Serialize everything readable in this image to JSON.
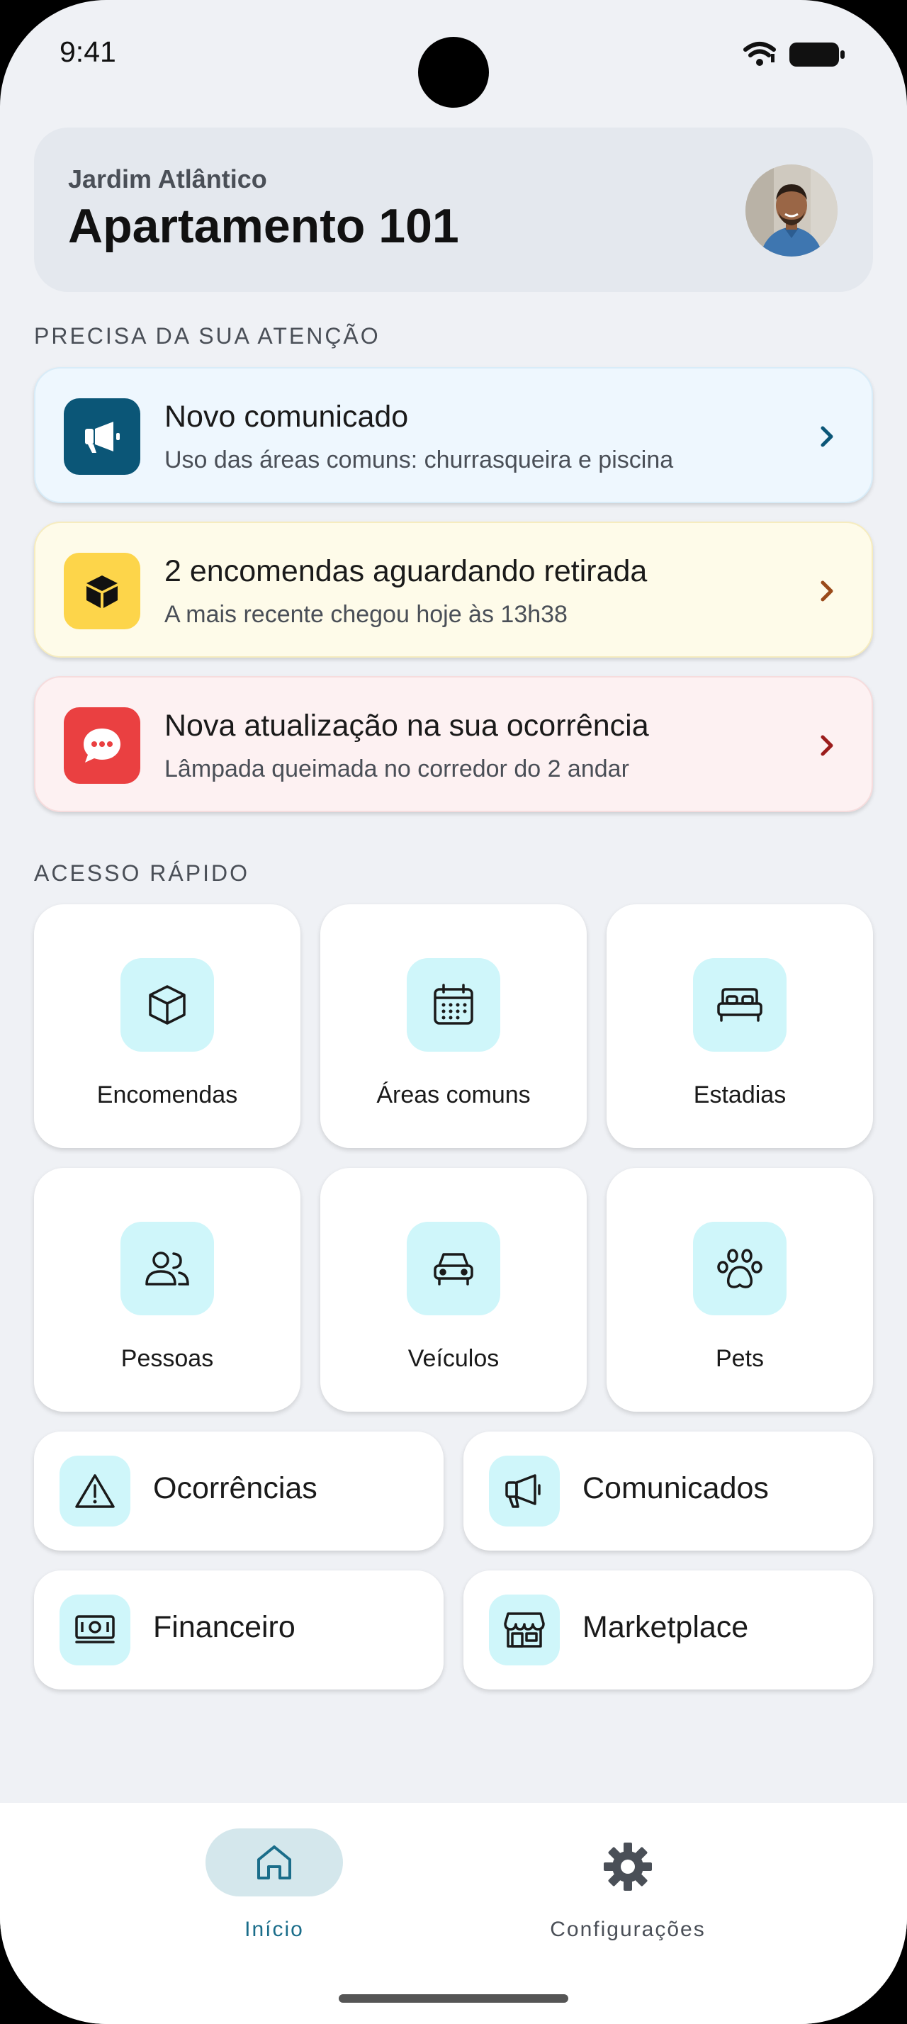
{
  "status_bar": {
    "time": "9:41"
  },
  "header": {
    "condominium": "Jardim Atlântico",
    "unit": "Apartamento 101",
    "avatar_icon": "user-avatar-photo"
  },
  "attention": {
    "section_title": "PRECISA DA SUA ATENÇÃO",
    "items": [
      {
        "title": "Novo comunicado",
        "subtitle": "Uso das áreas comuns: churrasqueira e piscina",
        "icon": "megaphone-icon",
        "bg": "#eef7fe",
        "icon_bg": "#0b5677",
        "chevron_color": "#0b5677"
      },
      {
        "title": "2 encomendas aguardando retirada",
        "subtitle": "A mais recente chegou hoje às 13h38",
        "icon": "package-icon",
        "bg": "#fefbe9",
        "icon_bg": "#fdd54a",
        "chevron_color": "#9a4a1a"
      },
      {
        "title": "Nova atualização na sua ocorrência",
        "subtitle": "Lâmpada queimada no corredor do 2 andar",
        "icon": "chat-bubble-icon",
        "bg": "#fdf1f2",
        "icon_bg": "#ea4041",
        "chevron_color": "#9b1c1c"
      }
    ]
  },
  "quick_access": {
    "section_title": "ACESSO RÁPIDO",
    "tiles": [
      {
        "label": "Encomendas",
        "icon": "box-icon"
      },
      {
        "label": "Áreas comuns",
        "icon": "calendar-icon"
      },
      {
        "label": "Estadias",
        "icon": "bed-icon"
      },
      {
        "label": "Pessoas",
        "icon": "people-icon"
      },
      {
        "label": "Veículos",
        "icon": "car-icon"
      },
      {
        "label": "Pets",
        "icon": "paw-icon"
      }
    ],
    "rows": [
      {
        "label": "Ocorrências",
        "icon": "warning-icon"
      },
      {
        "label": "Comunicados",
        "icon": "megaphone-icon"
      },
      {
        "label": "Financeiro",
        "icon": "money-icon"
      },
      {
        "label": "Marketplace",
        "icon": "store-icon"
      }
    ]
  },
  "bottom_nav": {
    "items": [
      {
        "label": "Início",
        "icon": "home-icon",
        "active": true
      },
      {
        "label": "Configurações",
        "icon": "gear-icon",
        "active": false
      }
    ],
    "active_color": "#1a6d8a",
    "inactive_color": "#4a4f57"
  },
  "colors": {
    "background": "#eff1f5",
    "tile_icon_bg": "#cff6fa"
  }
}
